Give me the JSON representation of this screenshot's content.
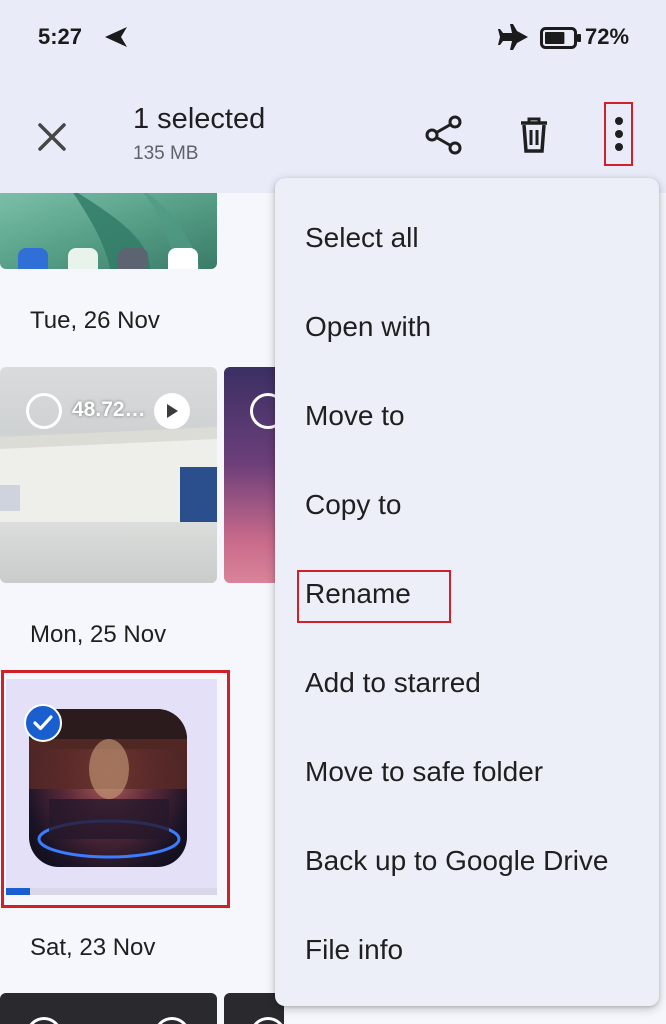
{
  "status_bar": {
    "time": "5:27",
    "battery_percent": "72%",
    "battery_level": 0.72,
    "icons": [
      "navigation-arrow-icon",
      "airplane-icon",
      "battery-icon"
    ]
  },
  "app_bar": {
    "title": "1 selected",
    "subtitle": "135 MB",
    "icons": [
      "close-icon",
      "share-icon",
      "delete-icon",
      "more-vert-icon"
    ]
  },
  "gallery": {
    "dates": [
      "Tue, 26 Nov",
      "Mon, 25 Nov",
      "Sat, 23 Nov"
    ],
    "video_duration": "48.72…"
  },
  "menu": {
    "items": [
      "Select all",
      "Open with",
      "Move to",
      "Copy to",
      "Rename",
      "Add to starred",
      "Move to safe folder",
      "Back up to Google Drive",
      "File info"
    ],
    "highlighted": "Rename"
  },
  "colors": {
    "accent": "#1a5fd0",
    "highlight_border": "#d0202a",
    "app_bar_bg": "#e9ecf8",
    "menu_bg": "#eceef8"
  }
}
